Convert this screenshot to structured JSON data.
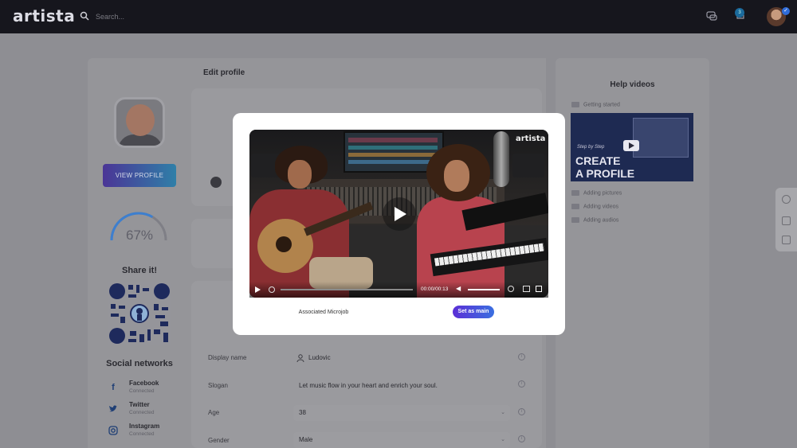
{
  "app": {
    "logo": "artista"
  },
  "search": {
    "placeholder": "Search..."
  },
  "topbar": {
    "notif_count": "3"
  },
  "sidebar": {
    "view_profile": "VIEW PROFILE",
    "progress_label": "67%",
    "progress_value": 0.67,
    "share_title": "Share it!",
    "social_title": "Social networks",
    "social": [
      {
        "name": "Facebook",
        "status": "Connected",
        "icon": "facebook-icon"
      },
      {
        "name": "Twitter",
        "status": "Connected",
        "icon": "twitter-icon"
      },
      {
        "name": "Instagram",
        "status": "Connected",
        "icon": "instagram-icon"
      }
    ]
  },
  "main": {
    "title": "Edit profile",
    "form": [
      {
        "label": "Display name",
        "value": "Ludovic"
      },
      {
        "label": "Slogan",
        "value": "Let music flow in your heart and enrich your soul."
      },
      {
        "label": "Age",
        "value": "38"
      },
      {
        "label": "Gender",
        "value": "Male"
      }
    ]
  },
  "help": {
    "title": "Help videos",
    "items": [
      "Getting started",
      "Adding pictures",
      "Adding videos",
      "Adding audios"
    ],
    "thumb_line1": "CREATE",
    "thumb_line2": "A PROFILE"
  },
  "modal": {
    "video_brand": "artista",
    "time": "00:00/00:13",
    "associated": "Associated Microjob",
    "set_main": "Set as main"
  },
  "colors": {
    "accent_start": "#5b2fd6",
    "accent_end": "#3a6fe0",
    "topbar": "#16161d"
  }
}
